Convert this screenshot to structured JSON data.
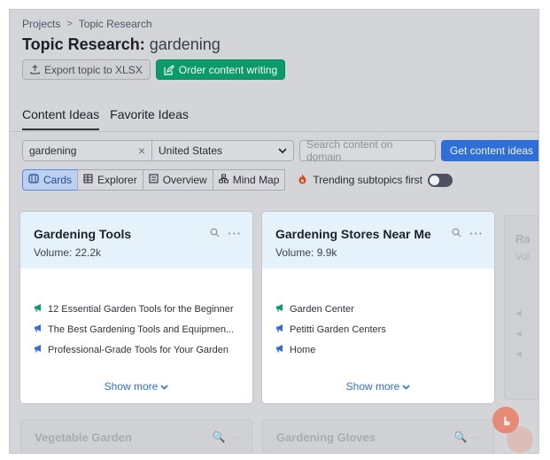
{
  "breadcrumb": {
    "root": "Projects",
    "current": "Topic Research"
  },
  "page_title": {
    "prefix": "Topic Research:",
    "keyword": "gardening"
  },
  "actions": {
    "export_label": "Export topic to XLSX",
    "order_label": "Order content writing"
  },
  "tabs": [
    {
      "label": "Content Ideas",
      "active": true
    },
    {
      "label": "Favorite Ideas",
      "active": false
    }
  ],
  "filters": {
    "topic_value": "gardening",
    "country_value": "United States",
    "domain_placeholder": "Search content on domain",
    "get_button": "Get content ideas"
  },
  "views": [
    {
      "label": "Cards",
      "icon": "cards-icon"
    },
    {
      "label": "Explorer",
      "icon": "table-icon"
    },
    {
      "label": "Overview",
      "icon": "overview-icon"
    },
    {
      "label": "Mind Map",
      "icon": "mindmap-icon"
    }
  ],
  "trending_label": "Trending subtopics first",
  "cards": [
    {
      "title": "Gardening Tools",
      "volume": "Volume: 22.2k",
      "headlines": [
        {
          "text": "12 Essential Garden Tools for the Beginner",
          "color": "#0c9a6a"
        },
        {
          "text": "The Best Gardening Tools and Equipmen...",
          "color": "#2f6fd6"
        },
        {
          "text": "Professional-Grade Tools for Your Garden",
          "color": "#2f6fd6"
        }
      ],
      "show_more": "Show more"
    },
    {
      "title": "Gardening Stores Near Me",
      "volume": "Volume: 9.9k",
      "headlines": [
        {
          "text": "Garden Center",
          "color": "#0c9a6a"
        },
        {
          "text": "Petitti Garden Centers",
          "color": "#2f6fd6"
        },
        {
          "text": "Home",
          "color": "#2f6fd6"
        }
      ],
      "show_more": "Show more"
    }
  ],
  "partial_card": {
    "title_fragment": "Ra",
    "volume_fragment": "Vol"
  },
  "bottom_cards": [
    {
      "title": "Vegetable Garden"
    },
    {
      "title": "Gardening Gloves"
    }
  ],
  "colors": {
    "accent_blue": "#2f6fd6",
    "accent_green": "#0c9a6a",
    "card_header": "#e5f2fc"
  }
}
